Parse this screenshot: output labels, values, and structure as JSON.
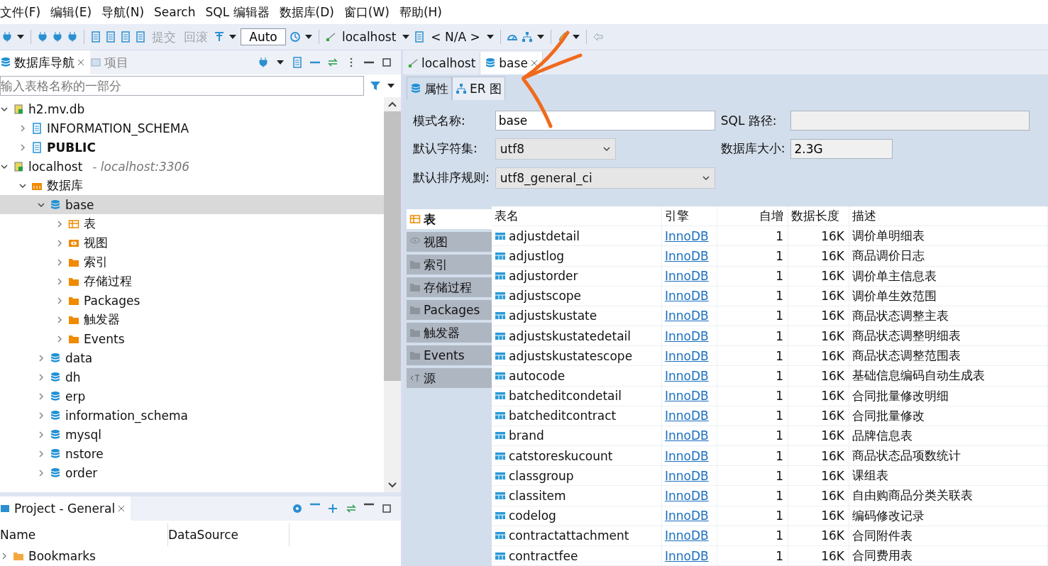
{
  "menu": [
    "文件(F)",
    "编辑(E)",
    "导航(N)",
    "Search",
    "SQL 编辑器",
    "数据库(D)",
    "窗口(W)",
    "帮助(H)"
  ],
  "toolbar": [
    {
      "kind": "icon"
    },
    {
      "kind": "caret"
    },
    {
      "kind": "sep"
    },
    {
      "kind": "icon"
    },
    {
      "kind": "icon"
    },
    {
      "kind": "icon"
    },
    {
      "kind": "sep"
    },
    {
      "kind": "icon"
    },
    {
      "kind": "icon"
    },
    {
      "kind": "icon"
    },
    {
      "kind": "icon"
    },
    {
      "kind": "button",
      "label": "提交",
      "disabled": true
    },
    {
      "kind": "button",
      "label": "回滚",
      "disabled": true
    },
    {
      "kind": "icon"
    },
    {
      "kind": "caret"
    },
    {
      "kind": "field",
      "value": "Auto"
    },
    {
      "kind": "icon"
    },
    {
      "kind": "caret"
    },
    {
      "kind": "sep"
    },
    {
      "kind": "dropdown",
      "label": "localhost"
    },
    {
      "kind": "dropdown",
      "label": "< N/A >"
    },
    {
      "kind": "sep"
    },
    {
      "kind": "icon"
    },
    {
      "kind": "icon"
    },
    {
      "kind": "caret"
    },
    {
      "kind": "sep"
    },
    {
      "kind": "icon"
    },
    {
      "kind": "caret"
    },
    {
      "kind": "sep"
    },
    {
      "kind": "icon"
    }
  ],
  "navigator": {
    "tabs": [
      {
        "label": "数据库导航",
        "selected": true
      },
      {
        "label": "项目",
        "selected": false
      }
    ],
    "filter": {
      "placeholder": "输入表格名称的一部分"
    },
    "tree": [
      {
        "label": "h2.mv.db",
        "kind": "connection",
        "expanded": true,
        "selected": false,
        "children": [
          {
            "label": "INFORMATION_SCHEMA",
            "kind": "schema",
            "expanded": false,
            "selected": false,
            "bold": false
          },
          {
            "label": "PUBLIC",
            "kind": "schema",
            "expanded": false,
            "selected": false,
            "bold": true
          }
        ]
      },
      {
        "label": "localhost",
        "detail": "- localhost:3306",
        "kind": "connection",
        "expanded": true,
        "selected": false,
        "children": [
          {
            "label": "数据库",
            "kind": "databases",
            "expanded": true,
            "selected": false,
            "children": [
              {
                "label": "base",
                "kind": "database",
                "expanded": true,
                "selected": true,
                "children": [
                  {
                    "label": "表",
                    "kind": "tables",
                    "expanded": false,
                    "selected": false
                  },
                  {
                    "label": "视图",
                    "kind": "views",
                    "expanded": false,
                    "selected": false
                  },
                  {
                    "label": "索引",
                    "kind": "folder",
                    "expanded": false,
                    "selected": false
                  },
                  {
                    "label": "存储过程",
                    "kind": "folder",
                    "expanded": false,
                    "selected": false
                  },
                  {
                    "label": "Packages",
                    "kind": "folder",
                    "expanded": false,
                    "selected": false
                  },
                  {
                    "label": "触发器",
                    "kind": "folder",
                    "expanded": false,
                    "selected": false
                  },
                  {
                    "label": "Events",
                    "kind": "folder",
                    "expanded": false,
                    "selected": false
                  }
                ]
              },
              {
                "label": "data",
                "kind": "database",
                "expanded": false,
                "selected": false
              },
              {
                "label": "dh",
                "kind": "database",
                "expanded": false,
                "selected": false
              },
              {
                "label": "erp",
                "kind": "database",
                "expanded": false,
                "selected": false
              },
              {
                "label": "information_schema",
                "kind": "database",
                "expanded": false,
                "selected": false
              },
              {
                "label": "mysql",
                "kind": "database",
                "expanded": false,
                "selected": false
              },
              {
                "label": "nstore",
                "kind": "database",
                "expanded": false,
                "selected": false
              },
              {
                "label": "order",
                "kind": "database",
                "expanded": false,
                "selected": false
              }
            ]
          }
        ]
      }
    ]
  },
  "project": {
    "title": "Project - General",
    "columns": [
      "Name",
      "DataSource"
    ],
    "rows": [
      {
        "label": "Bookmarks"
      }
    ]
  },
  "editor": {
    "tabs": [
      {
        "label": "localhost",
        "selected": false
      },
      {
        "label": "base",
        "selected": true
      }
    ],
    "subtabs": [
      {
        "label": "属性",
        "selected": true
      },
      {
        "label": "ER 图",
        "selected": false
      }
    ],
    "form": {
      "schema_name_label": "模式名称:",
      "schema_name": "base",
      "sql_path_label": "SQL 路径:",
      "charset_label": "默认字符集:",
      "charset": "utf8",
      "size_label": "数据库大小:",
      "size": "2.3G",
      "collation_label": "默认排序规则:",
      "collation": "utf8_general_ci"
    },
    "side_tabs": [
      {
        "label": "表",
        "selected": true
      },
      {
        "label": "视图",
        "selected": false
      },
      {
        "label": "索引",
        "selected": false
      },
      {
        "label": "存储过程",
        "selected": false
      },
      {
        "label": "Packages",
        "selected": false
      },
      {
        "label": "触发器",
        "selected": false
      },
      {
        "label": "Events",
        "selected": false
      },
      {
        "label": "源",
        "selected": false
      }
    ],
    "table": {
      "columns": [
        "表名",
        "引擎",
        "自增",
        "数据长度",
        "描述"
      ],
      "rows": [
        [
          "adjustdetail",
          "InnoDB",
          "1",
          "16K",
          "调价单明细表"
        ],
        [
          "adjustlog",
          "InnoDB",
          "1",
          "16K",
          "商品调价日志"
        ],
        [
          "adjustorder",
          "InnoDB",
          "1",
          "16K",
          "调价单主信息表"
        ],
        [
          "adjustscope",
          "InnoDB",
          "1",
          "16K",
          "调价单生效范围"
        ],
        [
          "adjustskustate",
          "InnoDB",
          "1",
          "16K",
          "商品状态调整主表"
        ],
        [
          "adjustskustatedetail",
          "InnoDB",
          "1",
          "16K",
          "商品状态调整明细表"
        ],
        [
          "adjustskustatescope",
          "InnoDB",
          "1",
          "16K",
          "商品状态调整范围表"
        ],
        [
          "autocode",
          "InnoDB",
          "1",
          "16K",
          "基础信息编码自动生成表"
        ],
        [
          "batcheditcondetail",
          "InnoDB",
          "1",
          "16K",
          "合同批量修改明细"
        ],
        [
          "batcheditcontract",
          "InnoDB",
          "1",
          "16K",
          "合同批量修改"
        ],
        [
          "brand",
          "InnoDB",
          "1",
          "16K",
          "品牌信息表"
        ],
        [
          "catstoreskucount",
          "InnoDB",
          "1",
          "16K",
          "商品状态品项数统计"
        ],
        [
          "classgroup",
          "InnoDB",
          "1",
          "16K",
          "课组表"
        ],
        [
          "classitem",
          "InnoDB",
          "1",
          "16K",
          "自由购商品分类关联表"
        ],
        [
          "codelog",
          "InnoDB",
          "1",
          "16K",
          "编码修改记录"
        ],
        [
          "contractattachment",
          "InnoDB",
          "1",
          "16K",
          "合同附件表"
        ],
        [
          "contractfee",
          "InnoDB",
          "1",
          "16K",
          "合同费用表"
        ]
      ]
    }
  }
}
